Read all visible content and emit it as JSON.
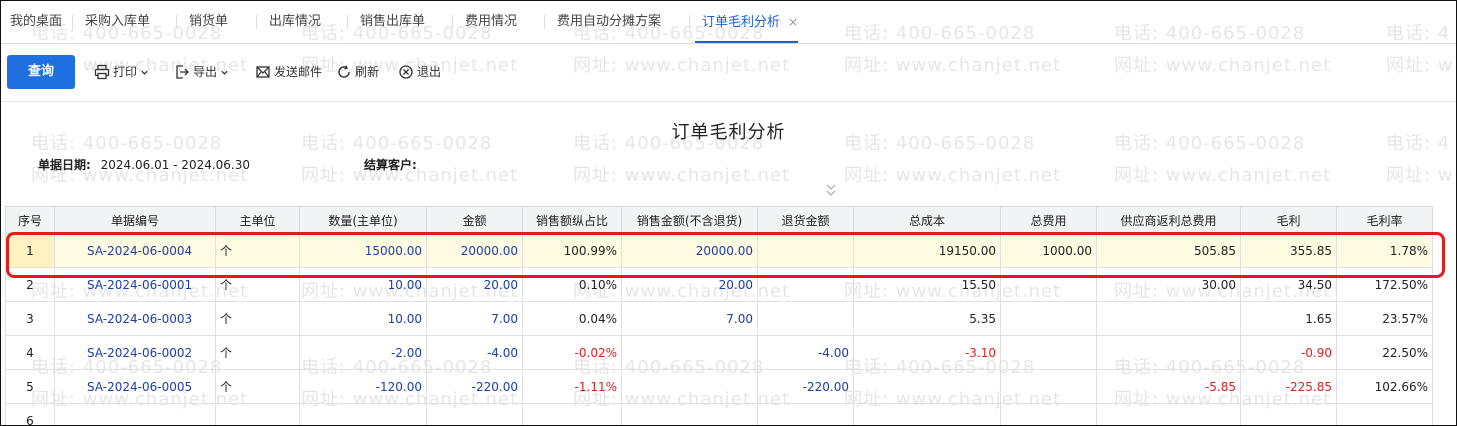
{
  "tabs": [
    {
      "label": "我的桌面"
    },
    {
      "label": "采购入库单"
    },
    {
      "label": "销货单"
    },
    {
      "label": "出库情况"
    },
    {
      "label": "销售出库单"
    },
    {
      "label": "费用情况"
    },
    {
      "label": "费用自动分摊方案"
    },
    {
      "label": "订单毛利分析",
      "close": "×"
    }
  ],
  "toolbar": {
    "query": "查询",
    "print": "打印",
    "export": "导出",
    "send_mail": "发送邮件",
    "refresh": "刷新",
    "exit": "退出"
  },
  "watermark": {
    "phone": "电话: 400-665-0028",
    "site": "网址: www.chanjet.net",
    "phone_partial": "电话: 4",
    "site_partial": "网址: w"
  },
  "report": {
    "title": "订单毛利分析",
    "date_label": "单据日期:",
    "date_value": "2024.06.01 - 2024.06.30",
    "customer_label": "结算客户:",
    "customer_value": ""
  },
  "columns": [
    "序号",
    "单据编号",
    "主单位",
    "数量(主单位)",
    "金额",
    "销售额纵占比",
    "销售金额(不含退货)",
    "退货金额",
    "总成本",
    "总费用",
    "供应商返利总费用",
    "毛利",
    "毛利率"
  ],
  "rows": [
    {
      "no": "1",
      "code": "SA-2024-06-0004",
      "unit": "个",
      "qty": "15000.00",
      "amount": "20000.00",
      "ratio": "100.99%",
      "sales": "20000.00",
      "return": "",
      "cost": "19150.00",
      "fee": "1000.00",
      "rebate": "505.85",
      "profit": "355.85",
      "rate": "1.78%"
    },
    {
      "no": "2",
      "code": "SA-2024-06-0001",
      "unit": "个",
      "qty": "10.00",
      "amount": "20.00",
      "ratio": "0.10%",
      "sales": "20.00",
      "return": "",
      "cost": "15.50",
      "fee": "",
      "rebate": "30.00",
      "profit": "34.50",
      "rate": "172.50%"
    },
    {
      "no": "3",
      "code": "SA-2024-06-0003",
      "unit": "个",
      "qty": "10.00",
      "amount": "7.00",
      "ratio": "0.04%",
      "sales": "7.00",
      "return": "",
      "cost": "5.35",
      "fee": "",
      "rebate": "",
      "profit": "1.65",
      "rate": "23.57%"
    },
    {
      "no": "4",
      "code": "SA-2024-06-0002",
      "unit": "个",
      "qty": "-2.00",
      "amount": "-4.00",
      "ratio": "-0.02%",
      "sales": "",
      "return": "-4.00",
      "cost": "-3.10",
      "fee": "",
      "rebate": "",
      "profit": "-0.90",
      "rate": "22.50%"
    },
    {
      "no": "5",
      "code": "SA-2024-06-0005",
      "unit": "个",
      "qty": "-120.00",
      "amount": "-220.00",
      "ratio": "-1.11%",
      "sales": "",
      "return": "-220.00",
      "cost": "",
      "fee": "",
      "rebate": "-5.85",
      "profit": "-225.85",
      "rate": "102.66%"
    },
    {
      "no": "6",
      "code": "",
      "unit": "",
      "qty": "",
      "amount": "",
      "ratio": "",
      "sales": "",
      "return": "",
      "cost": "",
      "fee": "",
      "rebate": "",
      "profit": "",
      "rate": ""
    }
  ],
  "colors": {
    "accent": "#1e6fe0",
    "link": "#1b3fa8",
    "negative": "#e02020",
    "highlight": "#e21b1b",
    "selected_row": "#fffbe3"
  }
}
